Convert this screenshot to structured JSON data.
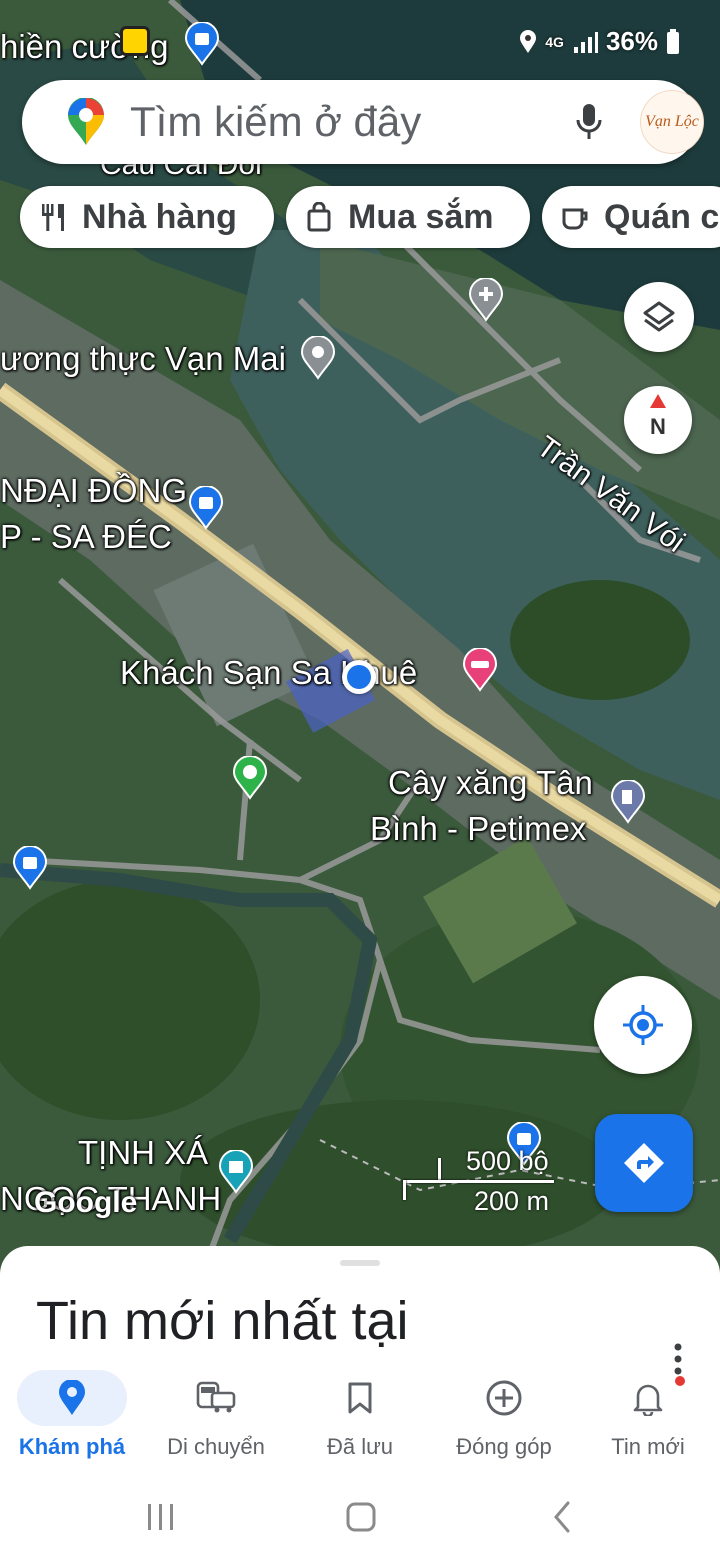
{
  "status_bar": {
    "battery": "36%",
    "network": "4G"
  },
  "search": {
    "placeholder": "Tìm kiếm ở đây",
    "avatar_text": "Vạn Lộc"
  },
  "chips": [
    {
      "label": "Nhà hàng",
      "icon": "restaurant-icon"
    },
    {
      "label": "Mua sắm",
      "icon": "shopping-bag-icon"
    },
    {
      "label": "Quán c",
      "icon": "coffee-icon"
    }
  ],
  "map_labels": {
    "top_left": "hiền cường",
    "bridge": "Cầu Cái Đôi",
    "luong_thuc": "ương thực Vạn Mai",
    "tran_van_voi": "Trần Văn Vói",
    "dai_dong": "NĐẠI ĐỒNG",
    "sa_dec": "P - SA ĐÉC",
    "hotel": "Khách Sạn Sa Khuê",
    "gas_line1": "Cây xăng Tân",
    "gas_line2": "Bình - Petimex",
    "tinh_xa_line1": "TỊNH XÁ",
    "tinh_xa_line2": "NGỌC THANH"
  },
  "compass": {
    "label": "N"
  },
  "scale": {
    "imperial": "500 bộ",
    "metric": "200 m"
  },
  "google_logo": "Google",
  "sheet": {
    "title": "Tin mới nhất tại"
  },
  "bottom_nav": [
    {
      "label": "Khám phá",
      "icon": "explore-pin-icon",
      "active": true
    },
    {
      "label": "Di chuyển",
      "icon": "commute-icon",
      "active": false
    },
    {
      "label": "Đã lưu",
      "icon": "bookmark-icon",
      "active": false
    },
    {
      "label": "Đóng góp",
      "icon": "add-circle-icon",
      "active": false
    },
    {
      "label": "Tin mới",
      "icon": "bell-icon",
      "active": false
    }
  ],
  "colors": {
    "accent": "#1a73e8",
    "hotel_pin": "#e8417a",
    "notification_dot": "#e53935"
  }
}
